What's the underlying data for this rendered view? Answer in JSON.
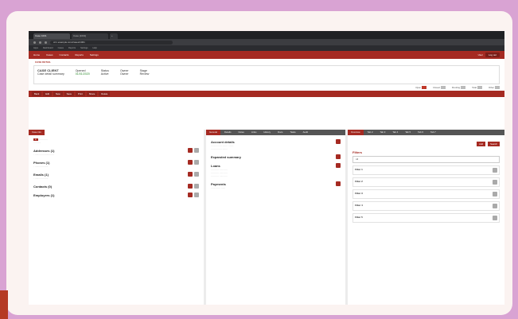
{
  "browser": {
    "tabs": [
      "Case 1001",
      "Case [1001]",
      "+"
    ],
    "url": "crm.example.com/cases/1001"
  },
  "bookmarks": [
    "Apps",
    "Dashboard",
    "Cases",
    "Reports",
    "Settings",
    "Help"
  ],
  "app": {
    "menu": [
      "Home",
      "Cases",
      "Contacts",
      "Reports",
      "Settings"
    ],
    "user": "User",
    "btn": "Log out"
  },
  "breadcrumb": "CASE DETAIL",
  "summary": {
    "name": "CASE CLIENT",
    "sub": "Case detail summary",
    "labels": [
      "Opened",
      "Status",
      "Owner",
      "Stage"
    ],
    "values": [
      "01/01/2020",
      "Active",
      "Owner",
      "Review"
    ]
  },
  "stats": [
    "Open",
    "Closed",
    "Pending",
    "Total",
    "Other"
  ],
  "actions": [
    "Back",
    "Edit",
    "New",
    "Save",
    "Print",
    "Share",
    "Delete"
  ],
  "left": {
    "tab": "Case info",
    "sections": [
      "Addresses (1)",
      "Phones (1)",
      "Emails (1)",
      "Contacts (0)",
      "Employers (1)"
    ]
  },
  "middle": {
    "tabs": [
      "General",
      "Details",
      "Notes",
      "Links",
      "History",
      "Docs",
      "Tasks",
      "Audit"
    ],
    "sections": [
      "Account details",
      "Expanded summary",
      "Loans",
      "Payments"
    ]
  },
  "right": {
    "tabs": [
      "Overview",
      "Tab 2",
      "Tab 3",
      "Tab 4",
      "Tab 5",
      "Tab 6",
      "Tab 7"
    ],
    "title": "Filters",
    "buttons": [
      "Add",
      "Search"
    ],
    "select": "All",
    "cards": [
      "Filter 1",
      "Filter 2",
      "Filter 3",
      "Filter 4",
      "Filter 5"
    ]
  }
}
